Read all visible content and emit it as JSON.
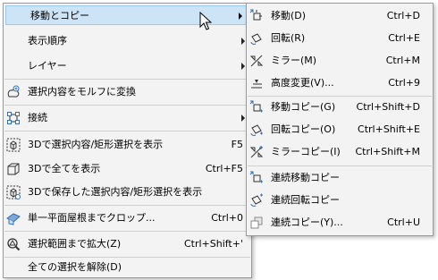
{
  "main_menu": {
    "items": [
      {
        "label": "移動とコピー",
        "shortcut": "",
        "icon": "",
        "submenu": true
      },
      {
        "label": "表示順序",
        "shortcut": "",
        "icon": "",
        "submenu": true
      },
      {
        "label": "レイヤー",
        "shortcut": "",
        "icon": "",
        "submenu": true
      },
      {
        "label": "選択内容をモルフに変換",
        "shortcut": "",
        "icon": "morph-convert-icon",
        "submenu": false
      },
      {
        "label": "接続",
        "shortcut": "",
        "icon": "connect-icon",
        "submenu": true
      },
      {
        "label": "3Dで選択内容/矩形選択を表示",
        "shortcut": "F5",
        "icon": "3d-selection-icon",
        "submenu": false
      },
      {
        "label": "3Dで全てを表示",
        "shortcut": "Ctrl+F5",
        "icon": "3d-all-icon",
        "submenu": false
      },
      {
        "label": "3Dで保存した選択内容/矩形選択を表示",
        "shortcut": "",
        "icon": "3d-saved-selection-icon",
        "submenu": false
      },
      {
        "label": "単一平面屋根までクロップ...",
        "shortcut": "Ctrl+0",
        "icon": "crop-roof-icon",
        "submenu": false
      },
      {
        "label": "選択範囲まで拡大(Z)",
        "shortcut": "Ctrl+Shift+'",
        "icon": "zoom-selection-icon",
        "submenu": false
      },
      {
        "label": "全ての選択を解除(D)",
        "shortcut": "",
        "icon": "",
        "submenu": false
      }
    ]
  },
  "sub_menu": {
    "items": [
      {
        "label": "移動(D)",
        "shortcut": "Ctrl+D",
        "icon": "move-icon"
      },
      {
        "label": "回転(R)",
        "shortcut": "Ctrl+E",
        "icon": "rotate-icon"
      },
      {
        "label": "ミラー(M)",
        "shortcut": "Ctrl+M",
        "icon": "mirror-icon"
      },
      {
        "label": "高度変更(V)...",
        "shortcut": "Ctrl+9",
        "icon": "elevate-icon"
      },
      {
        "label": "移動コピー(G)",
        "shortcut": "Ctrl+Shift+D",
        "icon": "move-copy-icon"
      },
      {
        "label": "回転コピー(O)",
        "shortcut": "Ctrl+Shift+E",
        "icon": "rotate-copy-icon"
      },
      {
        "label": "ミラーコピー(I)",
        "shortcut": "Ctrl+Shift+M",
        "icon": "mirror-copy-icon"
      },
      {
        "label": "連続移動コピー",
        "shortcut": "",
        "icon": "continuous-move-copy-icon"
      },
      {
        "label": "連続回転コピー",
        "shortcut": "",
        "icon": "continuous-rotate-copy-icon"
      },
      {
        "label": "連続コピー(Y)...",
        "shortcut": "Ctrl+U",
        "icon": "multiply-copy-icon"
      }
    ]
  },
  "colors": {
    "highlight": "#cde4f7",
    "highlight_border": "#99c9ef",
    "icon_accent": "#2f6fb5"
  }
}
